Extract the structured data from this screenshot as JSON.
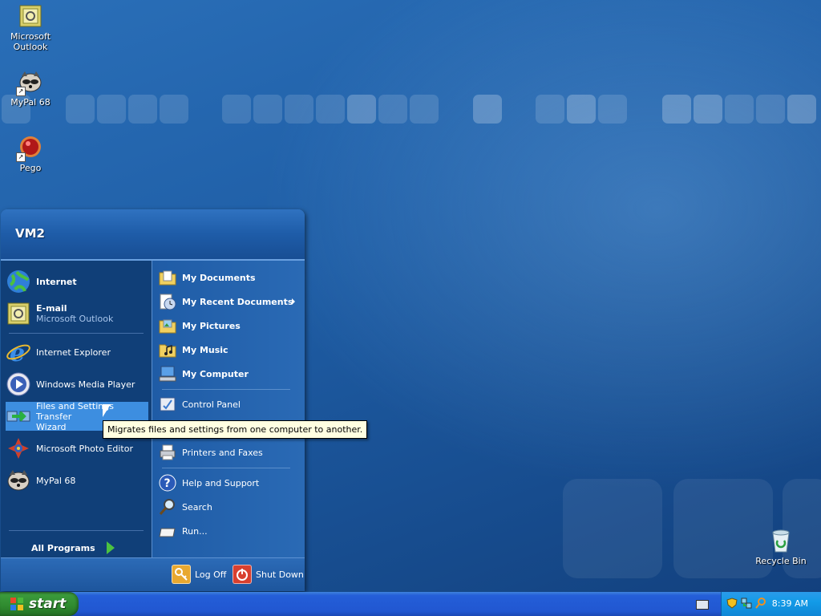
{
  "desktop": {
    "icons": [
      {
        "label": "Microsoft\nOutlook",
        "icon": "outlook-icon"
      },
      {
        "label": "MyPal 68",
        "icon": "raccoon-icon"
      },
      {
        "label": "Pego",
        "icon": "pego-icon"
      },
      {
        "label": "Recycle Bin",
        "icon": "recycle-bin-icon"
      }
    ],
    "outlook_line1": "Microsoft",
    "outlook_line2": "Outlook",
    "mypal_label": "MyPal 68",
    "pego_label": "Pego",
    "recycle_label": "Recycle Bin"
  },
  "start_menu": {
    "user": "VM2",
    "left": {
      "pinned": [
        {
          "label": "Internet",
          "icon": "globe-icon"
        },
        {
          "label": "E-mail",
          "sublabel": "Microsoft Outlook",
          "icon": "outlook-icon"
        }
      ],
      "recent": [
        {
          "label": "Internet Explorer",
          "icon": "internet-explorer-icon"
        },
        {
          "label": "Windows Media Player",
          "icon": "media-player-icon"
        },
        {
          "label": "Files and Settings Transfer",
          "label2": "Wizard",
          "icon": "transfer-wizard-icon"
        },
        {
          "label": "Microsoft Photo Editor",
          "icon": "photo-editor-icon"
        },
        {
          "label": "MyPal 68",
          "icon": "raccoon-icon"
        }
      ],
      "all_programs": "All Programs"
    },
    "right": {
      "items": [
        {
          "label": "My Documents",
          "icon": "folder-documents-icon"
        },
        {
          "label": "My Recent Documents",
          "icon": "recent-documents-icon"
        },
        {
          "label": "My Pictures",
          "icon": "folder-pictures-icon"
        },
        {
          "label": "My Music",
          "icon": "folder-music-icon"
        },
        {
          "label": "My Computer",
          "icon": "computer-icon"
        },
        {
          "label": "Control Panel",
          "icon": "control-panel-icon"
        },
        {
          "label": "Printers and Faxes",
          "icon": "printer-icon"
        },
        {
          "label": "Help and Support",
          "icon": "help-icon"
        },
        {
          "label": "Search",
          "icon": "search-icon"
        },
        {
          "label": "Run...",
          "icon": "run-icon"
        }
      ]
    },
    "footer": {
      "log_off": "Log Off",
      "shut_down": "Shut Down"
    }
  },
  "tooltip": "Migrates files and settings from one computer to another.",
  "taskbar": {
    "start_label": "start",
    "clock": "8:39 AM"
  },
  "colors": {
    "desktop": "#1f5ea6",
    "start_button": "#3b9a3b",
    "taskbar": "#245ed8",
    "highlight": "#3d8ee0"
  }
}
